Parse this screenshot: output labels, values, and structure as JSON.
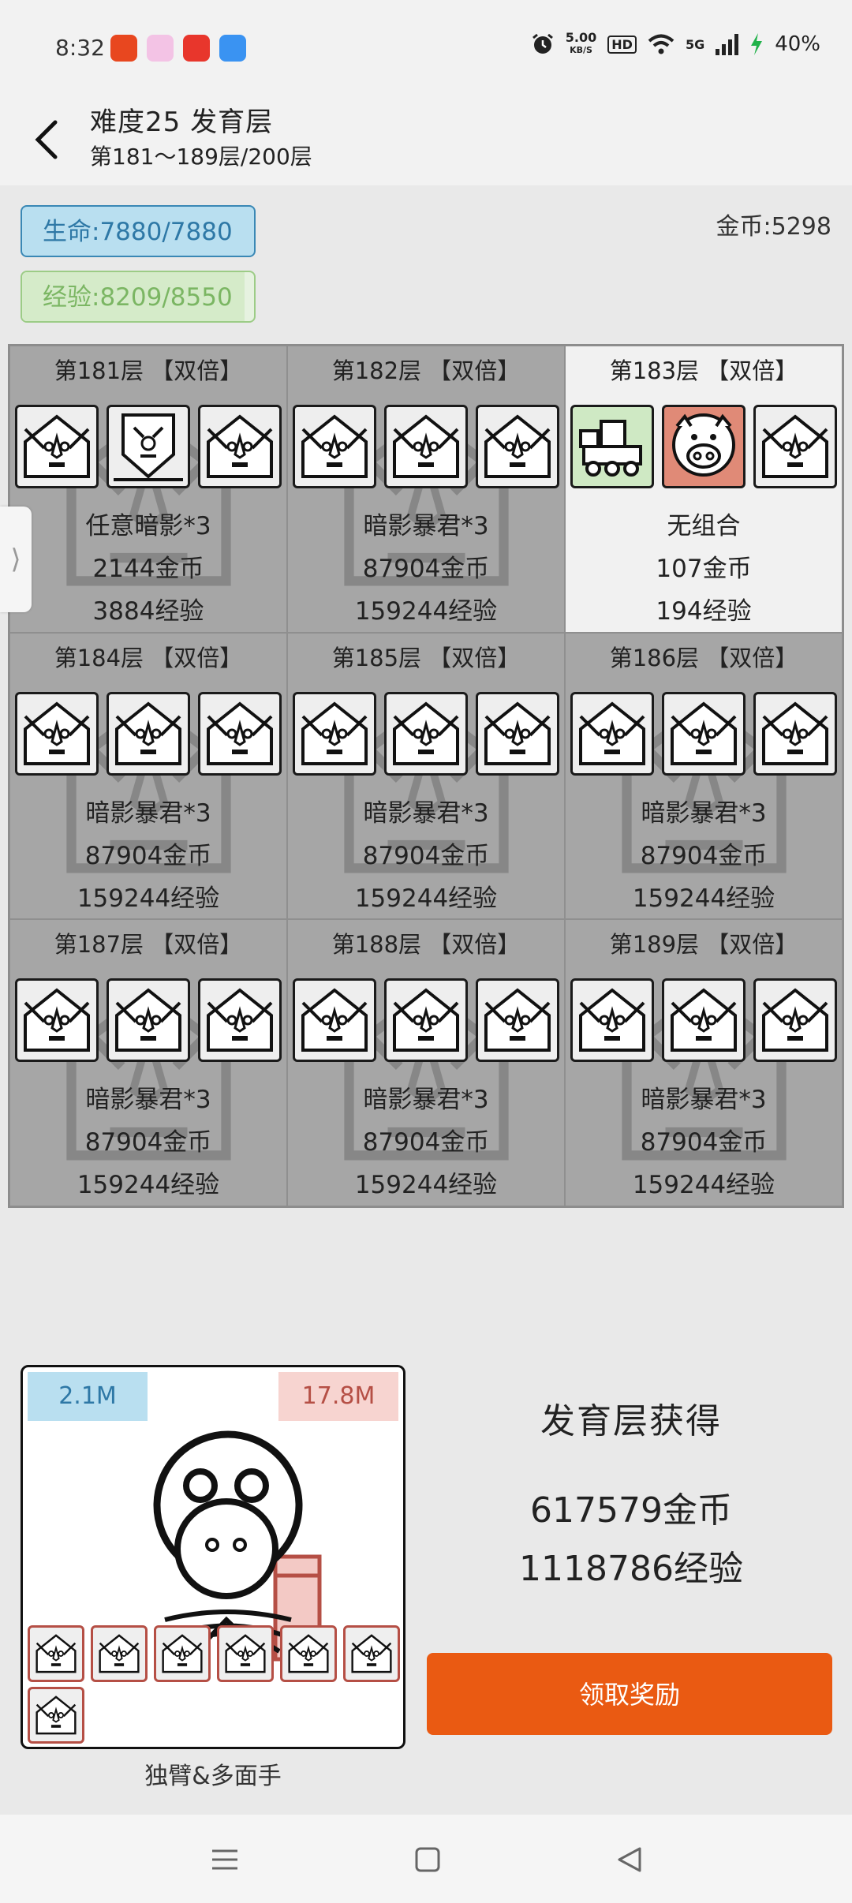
{
  "status_bar": {
    "time": "8:32",
    "net_speed_value": "5.00",
    "net_speed_unit": "KB/S",
    "hd": "HD",
    "signal": "5G",
    "battery": "40%"
  },
  "header": {
    "title": "难度25 发育层",
    "subtitle": "第181～189层/200层"
  },
  "stats": {
    "life": "生命:7880/7880",
    "exp": "经验:8209/8550",
    "exp_progress": 0.96,
    "gold": "金币:5298"
  },
  "side_tab": "⟩",
  "floors": [
    {
      "title": "第181层 【双倍】",
      "line1": "任意暗影*3",
      "line2": "2144金币",
      "line3": "3884经验",
      "active": false,
      "icons": [
        "ghost-icon",
        "mask-icon",
        "ghost-icon"
      ]
    },
    {
      "title": "第182层 【双倍】",
      "line1": "暗影暴君*3",
      "line2": "87904金币",
      "line3": "159244经验",
      "active": false,
      "icons": [
        "ghost-icon",
        "ghost-icon",
        "ghost-icon"
      ]
    },
    {
      "title": "第183层 【双倍】",
      "line1": "无组合",
      "line2": "107金币",
      "line3": "194经验",
      "active": true,
      "icons": [
        "cart-icon",
        "pig-icon",
        "ghost-icon"
      ]
    },
    {
      "title": "第184层 【双倍】",
      "line1": "暗影暴君*3",
      "line2": "87904金币",
      "line3": "159244经验",
      "active": false,
      "icons": [
        "ghost-icon",
        "ghost-icon",
        "ghost-icon"
      ]
    },
    {
      "title": "第185层 【双倍】",
      "line1": "暗影暴君*3",
      "line2": "87904金币",
      "line3": "159244经验",
      "active": false,
      "icons": [
        "ghost-icon",
        "ghost-icon",
        "ghost-icon"
      ]
    },
    {
      "title": "第186层 【双倍】",
      "line1": "暗影暴君*3",
      "line2": "87904金币",
      "line3": "159244经验",
      "active": false,
      "icons": [
        "ghost-icon",
        "ghost-icon",
        "ghost-icon"
      ]
    },
    {
      "title": "第187层 【双倍】",
      "line1": "暗影暴君*3",
      "line2": "87904金币",
      "line3": "159244经验",
      "active": false,
      "icons": [
        "ghost-icon",
        "ghost-icon",
        "ghost-icon"
      ]
    },
    {
      "title": "第188层 【双倍】",
      "line1": "暗影暴君*3",
      "line2": "87904金币",
      "line3": "159244经验",
      "active": false,
      "icons": [
        "ghost-icon",
        "ghost-icon",
        "ghost-icon"
      ]
    },
    {
      "title": "第189层 【双倍】",
      "line1": "暗影暴君*3",
      "line2": "87904金币",
      "line3": "159244经验",
      "active": false,
      "icons": [
        "ghost-icon",
        "ghost-icon",
        "ghost-icon"
      ]
    }
  ],
  "boss": {
    "left_stat": "2.1M",
    "right_stat": "17.8M",
    "name": "独臂&多面手",
    "minion_count": 7
  },
  "reward": {
    "title": "发育层获得",
    "gold": "617579金币",
    "exp": "1118786经验",
    "button": "领取奖励"
  },
  "colors": {
    "accent": "#ea5a12",
    "life_bg": "#b9dff0",
    "exp_bg": "#e6f2e0",
    "cell_gray": "#a6a6a6",
    "cell_active": "#f1f1f1"
  }
}
